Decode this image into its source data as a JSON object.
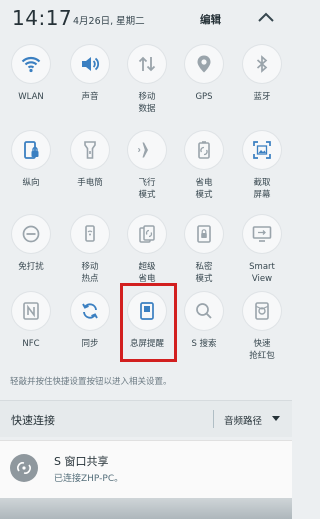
{
  "status": {
    "time": "14:17",
    "date": "4月26日, 星期二",
    "edit_label": "编辑"
  },
  "tiles": [
    {
      "label": "WLAN",
      "icon": "wifi-icon"
    },
    {
      "label": "声音",
      "icon": "speaker-icon"
    },
    {
      "label": "移动\n数据",
      "icon": "mobile-data-icon"
    },
    {
      "label": "GPS",
      "icon": "location-pin-icon"
    },
    {
      "label": "蓝牙",
      "icon": "bluetooth-icon"
    },
    {
      "label": "纵向",
      "icon": "portrait-lock-icon"
    },
    {
      "label": "手电筒",
      "icon": "flashlight-icon"
    },
    {
      "label": "飞行\n模式",
      "icon": "airplane-icon"
    },
    {
      "label": "省电\n模式",
      "icon": "power-saving-icon"
    },
    {
      "label": "截取\n屏幕",
      "icon": "screenshot-icon"
    },
    {
      "label": "免打扰",
      "icon": "do-not-disturb-icon"
    },
    {
      "label": "移动\n热点",
      "icon": "hotspot-icon"
    },
    {
      "label": "超级\n省电",
      "icon": "ultra-power-saving-icon"
    },
    {
      "label": "私密\n模式",
      "icon": "private-mode-icon"
    },
    {
      "label": "Smart\nView",
      "icon": "smart-view-icon"
    },
    {
      "label": "NFC",
      "icon": "nfc-icon"
    },
    {
      "label": "同步",
      "icon": "sync-icon"
    },
    {
      "label": "息屏提醒",
      "icon": "always-on-display-icon"
    },
    {
      "label": "S 搜索",
      "icon": "search-icon"
    },
    {
      "label": "快速\n抢红包",
      "icon": "red-packet-icon"
    }
  ],
  "hint": "轻敲并按住快捷设置按钮以进入相关设置。",
  "quick_connect": {
    "title": "快速连接",
    "audio_label": "音频路径"
  },
  "notification": {
    "title": "S 窗口共享",
    "subtitle": "已连接ZHP-PC。"
  },
  "colors": {
    "icon_blue": "#3a7fc1",
    "highlight_red": "#d21f1f",
    "panel_bg": "#eceff1"
  }
}
